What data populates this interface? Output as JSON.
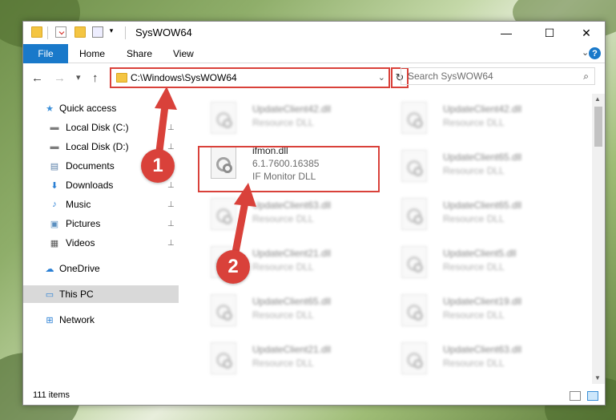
{
  "window": {
    "title": "SysWOW64",
    "minimize": "—",
    "maximize": "☐",
    "close": "✕"
  },
  "ribbon": {
    "tabs": [
      "File",
      "Home",
      "Share",
      "View"
    ],
    "expand_icon": "chevron-down-icon",
    "help": "?"
  },
  "nav": {
    "back": "←",
    "forward": "→",
    "recent": "▾",
    "up": "↑",
    "address": "C:\\Windows\\SysWOW64",
    "address_drop": "⌄",
    "refresh": "↻",
    "search_placeholder": "Search SysWOW64",
    "search_icon": "⌕"
  },
  "sidebar": {
    "items": [
      {
        "label": "Quick access",
        "icon": "star-icon",
        "glyph": "★",
        "color": "#3b8fd9",
        "pinned": false,
        "level": 1
      },
      {
        "label": "Local Disk (C:)",
        "icon": "drive-icon",
        "glyph": "▬",
        "color": "#7c7c7c",
        "pinned": true,
        "level": 2
      },
      {
        "label": "Local Disk (D:)",
        "icon": "drive-icon",
        "glyph": "▬",
        "color": "#7c7c7c",
        "pinned": true,
        "level": 2
      },
      {
        "label": "Documents",
        "icon": "documents-icon",
        "glyph": "▤",
        "color": "#5a7fa8",
        "pinned": true,
        "level": 2
      },
      {
        "label": "Downloads",
        "icon": "downloads-icon",
        "glyph": "⬇",
        "color": "#2a7fd4",
        "pinned": true,
        "level": 2
      },
      {
        "label": "Music",
        "icon": "music-icon",
        "glyph": "♪",
        "color": "#2a7fd4",
        "pinned": true,
        "level": 2
      },
      {
        "label": "Pictures",
        "icon": "pictures-icon",
        "glyph": "▣",
        "color": "#5a8fc0",
        "pinned": true,
        "level": 2
      },
      {
        "label": "Videos",
        "icon": "videos-icon",
        "glyph": "▦",
        "color": "#555555",
        "pinned": true,
        "level": 2
      },
      {
        "label": "OneDrive",
        "icon": "cloud-icon",
        "glyph": "☁",
        "color": "#2a7fd4",
        "pinned": false,
        "level": 1
      },
      {
        "label": "This PC",
        "icon": "computer-icon",
        "glyph": "▭",
        "color": "#2a7fd4",
        "pinned": false,
        "level": 1,
        "selected": true
      },
      {
        "label": "Network",
        "icon": "network-icon",
        "glyph": "⊞",
        "color": "#2a7fd4",
        "pinned": false,
        "level": 1
      }
    ],
    "pin_glyph": "📌"
  },
  "files": {
    "highlighted": {
      "name": "ifmon.dll",
      "version": "6.1.7600.16385",
      "description": "IF Monitor DLL"
    },
    "left_column": [
      {
        "name": "UpdateClient42.dll",
        "desc": "Resource DLL"
      },
      {
        "name": "UpdateClient63.dll",
        "desc": "Resource DLL"
      },
      {
        "name": "UpdateClient21.dll",
        "desc": "Resource DLL"
      },
      {
        "name": "UpdateClient65.dll",
        "desc": "Resource DLL"
      },
      {
        "name": "UpdateClient21.dll",
        "desc": "Resource DLL"
      }
    ],
    "right_column": [
      {
        "name": "UpdateClient42.dll",
        "desc": "Resource DLL"
      },
      {
        "name": "UpdateClient65.dll",
        "desc": "Resource DLL"
      },
      {
        "name": "UpdateClient65.dll",
        "desc": "Resource DLL"
      },
      {
        "name": "UpdateClient5.dll",
        "desc": "Resource DLL"
      },
      {
        "name": "UpdateClient19.dll",
        "desc": "Resource DLL"
      },
      {
        "name": "UpdateClient63.dll",
        "desc": "Resource DLL"
      }
    ]
  },
  "status": {
    "count": "111 items"
  },
  "annotations": {
    "step1": "1",
    "step2": "2",
    "color": "#d9413a"
  },
  "colors": {
    "accent": "#1979ca",
    "highlight": "#d9413a",
    "selected_bg": "#d9d9d9"
  }
}
